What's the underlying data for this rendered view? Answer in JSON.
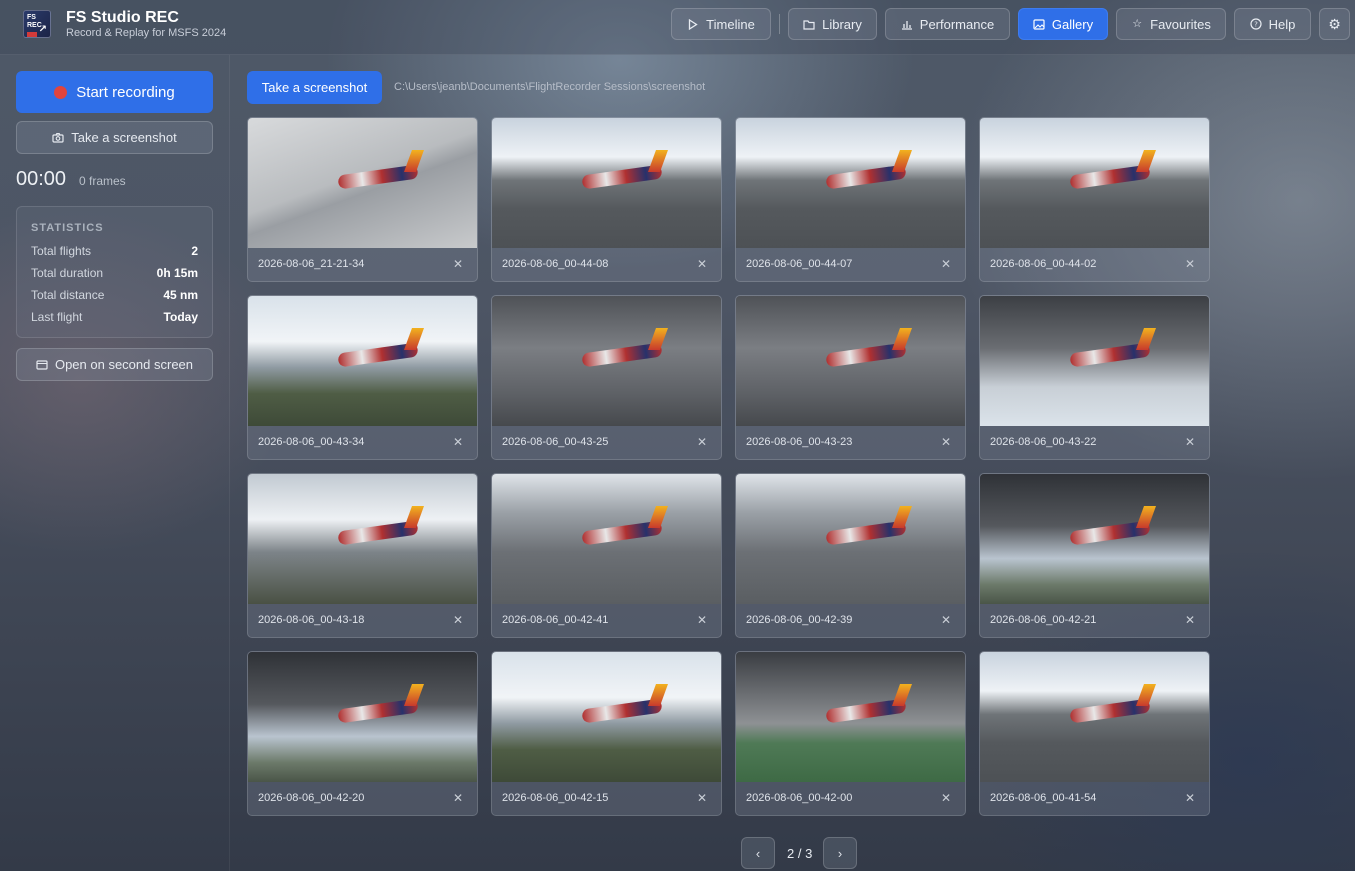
{
  "app": {
    "logo_text": "FS REC",
    "title": "FS Studio REC",
    "subtitle": "Record & Replay for MSFS 2024"
  },
  "nav": [
    {
      "label": "Timeline",
      "icon": "play-icon",
      "active": false
    },
    {
      "label": "Library",
      "icon": "folder-icon",
      "active": false
    },
    {
      "label": "Performance",
      "icon": "bar-chart-icon",
      "active": false
    },
    {
      "label": "Gallery",
      "icon": "image-icon",
      "active": true
    },
    {
      "label": "Favourites",
      "icon": "star-icon",
      "active": false
    },
    {
      "label": "Help",
      "icon": "help-circle-icon",
      "active": false
    }
  ],
  "settings_icon": "gear-icon",
  "sidebar": {
    "record_label": "Start recording",
    "screenshot_label": "Take a screenshot",
    "timer": "00:00",
    "frames": "0 frames",
    "stats_title": "STATISTICS",
    "stats": [
      {
        "label": "Total flights",
        "value": "2"
      },
      {
        "label": "Total duration",
        "value": "0h 15m"
      },
      {
        "label": "Total distance",
        "value": "45 nm"
      },
      {
        "label": "Last flight",
        "value": "Today"
      }
    ],
    "second_screen_label": "Open on second screen"
  },
  "main": {
    "screenshot_label": "Take a screenshot",
    "path": "C:\\Users\\jeanb\\Documents\\FlightRecorder Sessions\\screenshot"
  },
  "gallery": [
    {
      "name": "2026-08-06_21-21-34",
      "scene": "ground"
    },
    {
      "name": "2026-08-06_00-44-08",
      "scene": "runway"
    },
    {
      "name": "2026-08-06_00-44-07",
      "scene": "runway"
    },
    {
      "name": "2026-08-06_00-44-02",
      "scene": "runway"
    },
    {
      "name": "2026-08-06_00-43-34",
      "scene": "coast"
    },
    {
      "name": "2026-08-06_00-43-25",
      "scene": "storm"
    },
    {
      "name": "2026-08-06_00-43-23",
      "scene": "storm"
    },
    {
      "name": "2026-08-06_00-43-22",
      "scene": "clouds"
    },
    {
      "name": "2026-08-06_00-43-18",
      "scene": "wing"
    },
    {
      "name": "2026-08-06_00-42-41",
      "scene": "gear"
    },
    {
      "name": "2026-08-06_00-42-39",
      "scene": "gear"
    },
    {
      "name": "2026-08-06_00-42-21",
      "scene": "climb"
    },
    {
      "name": "2026-08-06_00-42-20",
      "scene": "climb"
    },
    {
      "name": "2026-08-06_00-42-15",
      "scene": "coast"
    },
    {
      "name": "2026-08-06_00-42-00",
      "scene": "grass"
    },
    {
      "name": "2026-08-06_00-41-54",
      "scene": "runway"
    }
  ],
  "pager": {
    "text": "2 / 3",
    "prev": "‹",
    "next": "›"
  },
  "close_glyph": "✕"
}
